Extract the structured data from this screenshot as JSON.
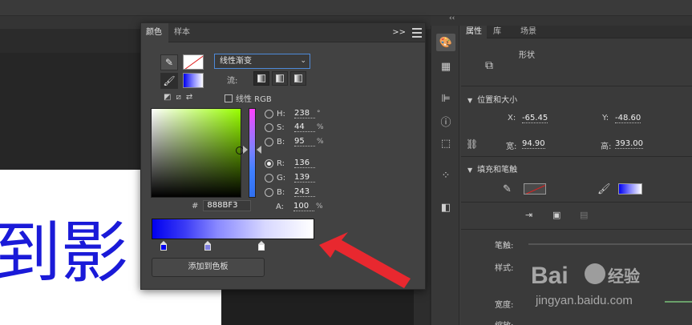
{
  "stage": {
    "big_text": "到影"
  },
  "color_panel": {
    "tabs": [
      "颜色",
      "样本"
    ],
    "collapse_label": ">>",
    "type_select": "线性渐变",
    "flow_label": "流:",
    "linear_rgb_label": "线性 RGB",
    "values": [
      {
        "label": "H:",
        "value": "238",
        "unit": "°",
        "checked": false
      },
      {
        "label": "S:",
        "value": "44",
        "unit": "%",
        "checked": false
      },
      {
        "label": "B:",
        "value": "95",
        "unit": "%",
        "checked": false
      },
      {
        "label": "R:",
        "value": "136",
        "unit": "",
        "checked": true
      },
      {
        "label": "G:",
        "value": "139",
        "unit": "",
        "checked": false
      },
      {
        "label": "B:",
        "value": "243",
        "unit": "",
        "checked": false
      }
    ],
    "hex_prefix": "#",
    "hex_value": "888BF3",
    "alpha_label": "A:",
    "alpha_value": "100",
    "alpha_unit": "%",
    "gradient_stops": [
      "#0000f0",
      "#7f7fe0",
      "#ffffff"
    ],
    "add_swatch_label": "添加到色板"
  },
  "properties": {
    "tabs": [
      "属性",
      "库",
      "场景"
    ],
    "shape_label": "形状",
    "section_position": "位置和大小",
    "x_label": "X:",
    "x_value": "-65.45",
    "y_label": "Y:",
    "y_value": "-48.60",
    "w_label": "宽:",
    "w_value": "94.90",
    "h_label": "高:",
    "h_value": "393.00",
    "section_fill": "填充和笔触",
    "stroke_label": "笔触:",
    "style_label": "样式:",
    "width_label": "宽度:",
    "scale_label": "缩放:"
  },
  "watermark": {
    "brand": "Baidu",
    "cn": "经验",
    "url": "jingyan.baidu.com"
  },
  "colors": {
    "accent": "#4e8ad8",
    "arrow": "#e8282f",
    "gradient_blue": "#0000f0"
  }
}
